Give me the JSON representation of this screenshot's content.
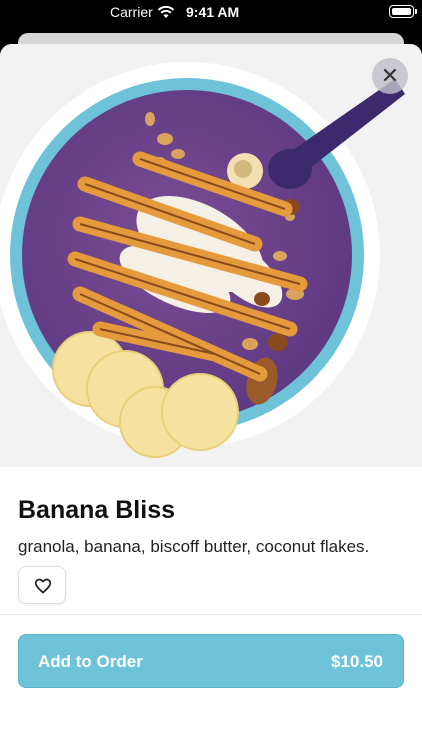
{
  "status_bar": {
    "carrier": "Carrier",
    "time": "9:41 AM"
  },
  "item": {
    "name": "Banana Bliss",
    "description": "granola, banana, biscoff butter, coconut flakes."
  },
  "actions": {
    "close_symbol": "✕",
    "add_to_order_label": "Add to Order",
    "price": "$10.50"
  },
  "icons": {
    "close": "close-icon",
    "favorite": "heart-icon",
    "wifi": "wifi-icon",
    "battery": "battery-icon"
  },
  "colors": {
    "accent": "#6ec3d8",
    "bowl_purple": "#5f3a82",
    "spoon": "#3d2a6e",
    "drizzle": "#e59a3c"
  }
}
